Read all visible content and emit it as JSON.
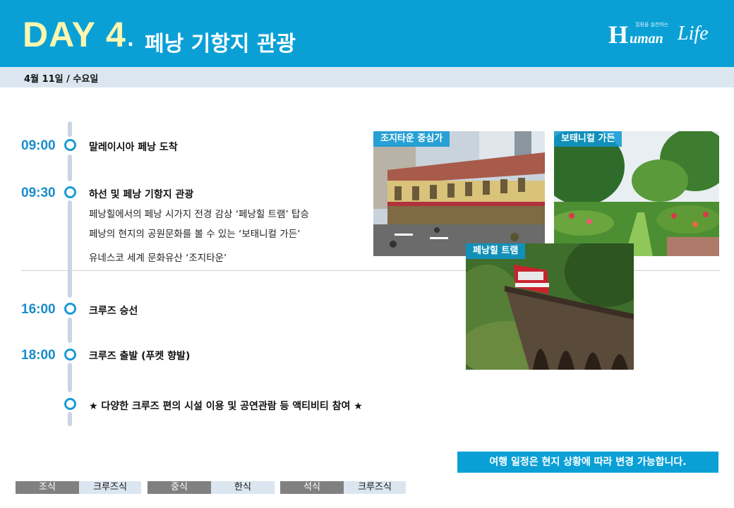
{
  "header": {
    "day_label": "DAY  4",
    "day_dot": ".",
    "title": "페낭 기항지 관광",
    "brand": {
      "h": "H",
      "uman": "uman",
      "life": "Life",
      "slogan": "힐링을 실천하는"
    },
    "bg_color": "#0aa0d6"
  },
  "date": {
    "text": "4월 11일 / 수요일"
  },
  "schedule": [
    {
      "time": "09:00",
      "title": "말레이시아 페낭 도착",
      "details": []
    },
    {
      "time": "09:30",
      "title": "하선 및 페낭 기항지 관광",
      "details": [
        "페낭힐에서의 페낭 시가지 전경 감상 ‘페낭힐 트램’ 탑승",
        "페낭의 현지의 공원문화를 볼 수 있는 ‘보태니컬 가든’",
        "유네스코 세계 문화유산 ‘조지타운’"
      ]
    },
    {
      "time": "16:00",
      "title": "크루즈 승선",
      "details": []
    },
    {
      "time": "18:00",
      "title": "크루즈 출발 (푸켓 향발)",
      "details": []
    },
    {
      "time": "",
      "title": "★ 다양한 크루즈 편의 시설 이용 및 공연관람 등 액티비티 참여 ★",
      "details": []
    }
  ],
  "photos": [
    {
      "label": "조지타운 중심가"
    },
    {
      "label": "보태니컬 가든"
    },
    {
      "label": "페낭힐 트램"
    }
  ],
  "notice": "여행 일정은 현지 상황에 따라 변경 가능합니다.",
  "meals": [
    {
      "label": "조식",
      "value": "크루즈식"
    },
    {
      "label": "중식",
      "value": "한식"
    },
    {
      "label": "석식",
      "value": "크루즈식"
    }
  ],
  "colors": {
    "accent": "#0aa0d6",
    "time": "#1a8ccb",
    "timeline": "#c9d5e2",
    "date_bar": "#dbe6f0",
    "meal_label": "#808080"
  }
}
